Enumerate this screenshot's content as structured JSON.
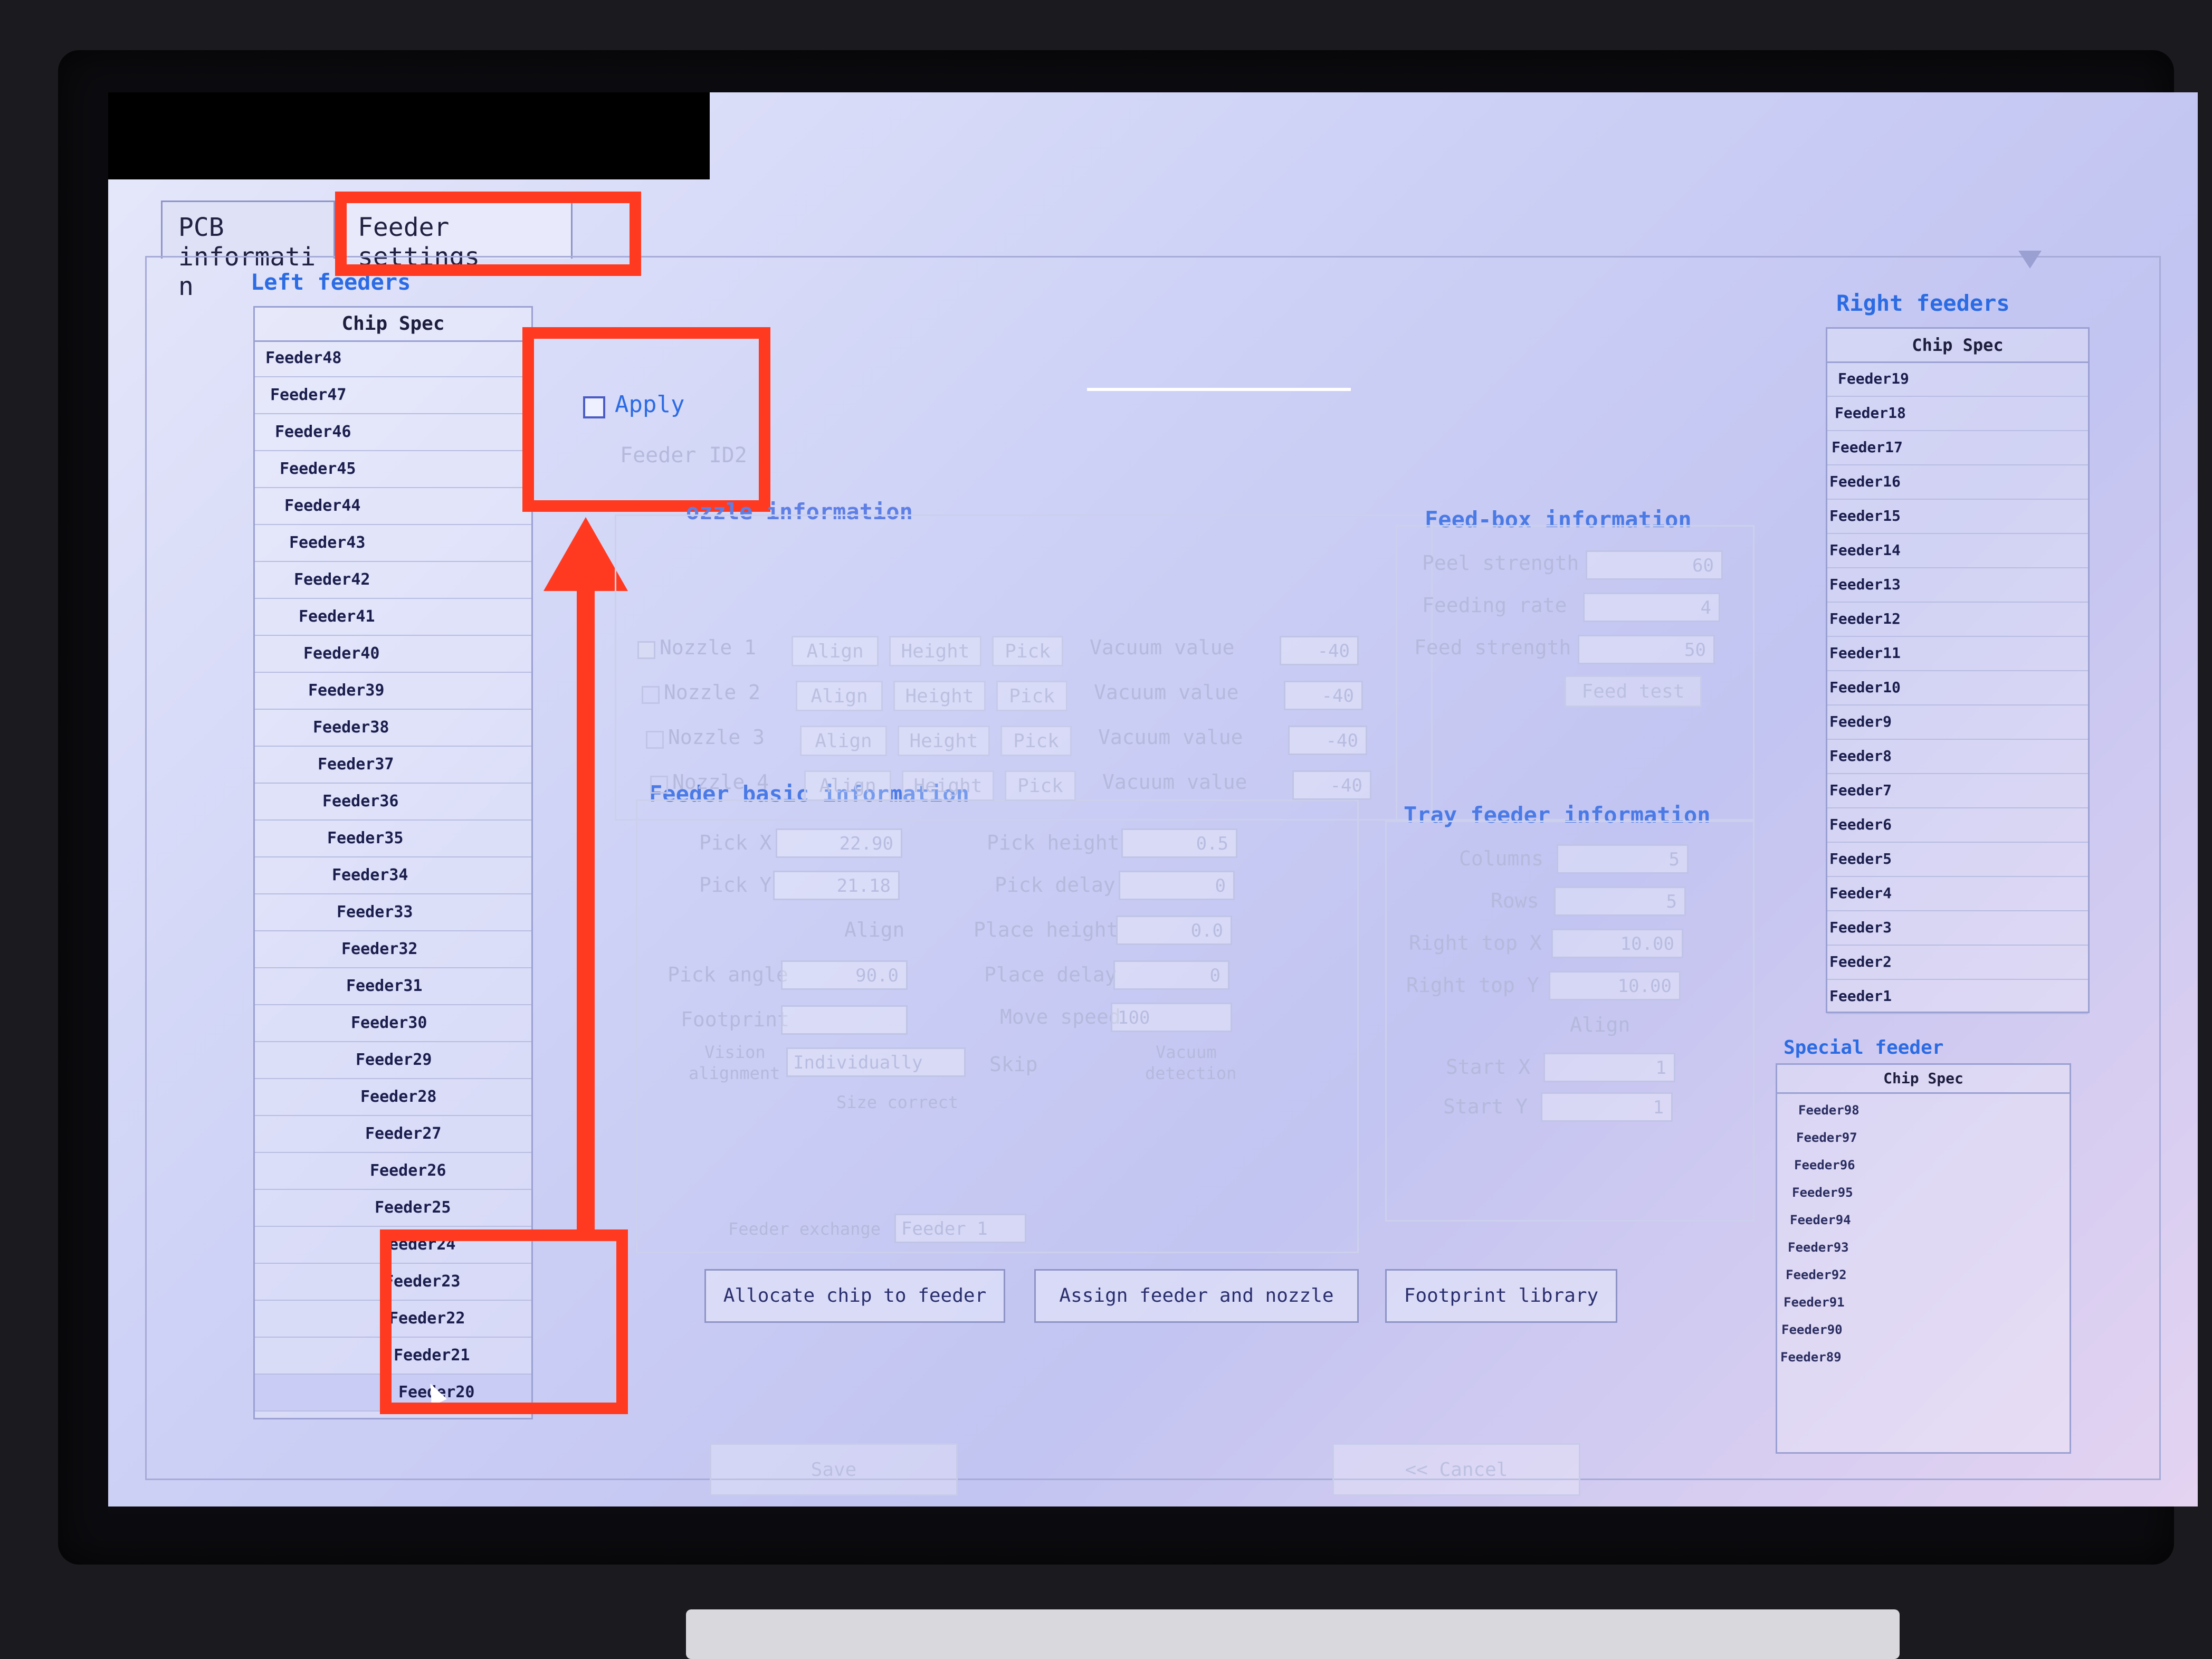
{
  "tabs": [
    {
      "label": "PCB informati n"
    },
    {
      "label": "Feeder settings"
    }
  ],
  "left_feeders": {
    "title": "Left feeders",
    "column": "Chip Spec",
    "rows": [
      "Feeder48",
      "Feeder47",
      "Feeder46",
      "Feeder45",
      "Feeder44",
      "Feeder43",
      "Feeder42",
      "Feeder41",
      "Feeder40",
      "Feeder39",
      "Feeder38",
      "Feeder37",
      "Feeder36",
      "Feeder35",
      "Feeder34",
      "Feeder33",
      "Feeder32",
      "Feeder31",
      "Feeder30",
      "Feeder29",
      "Feeder28",
      "Feeder27",
      "Feeder26",
      "Feeder25",
      "Feeder24",
      "Feeder23",
      "Feeder22",
      "Feeder21",
      "Feeder20"
    ],
    "selected": "Feeder20"
  },
  "right_feeders": {
    "title": "Right feeders",
    "column": "Chip Spec",
    "rows": [
      "Feeder19",
      "Feeder18",
      "Feeder17",
      "Feeder16",
      "Feeder15",
      "Feeder14",
      "Feeder13",
      "Feeder12",
      "Feeder11",
      "Feeder10",
      "Feeder9",
      "Feeder8",
      "Feeder7",
      "Feeder6",
      "Feeder5",
      "Feeder4",
      "Feeder3",
      "Feeder2",
      "Feeder1"
    ]
  },
  "special_feeder": {
    "title": "Special feeder",
    "column": "Chip Spec",
    "rows": [
      "Feeder98",
      "Feeder97",
      "Feeder96",
      "Feeder95",
      "Feeder94",
      "Feeder93",
      "Feeder92",
      "Feeder91",
      "Feeder90",
      "Feeder89"
    ]
  },
  "apply": {
    "label": "Apply",
    "checked": false
  },
  "feeder_id": "Feeder ID2",
  "nozzle_section": {
    "title": "ozzle information"
  },
  "nozzles": [
    {
      "label": "Nozzle 1",
      "checked": true,
      "value": "-40"
    },
    {
      "label": "Nozzle 2",
      "checked": false,
      "value": "-40"
    },
    {
      "label": "Nozzle 3",
      "checked": false,
      "value": "-40"
    },
    {
      "label": "Nozzle 4",
      "checked": false,
      "value": "-40"
    }
  ],
  "nozzle_buttons": {
    "align": "Align",
    "height": "Height",
    "pick": "Pick",
    "vacuum": "Vacuum value"
  },
  "feedbox": {
    "title": "Feed-box information",
    "peel_label": "Peel strength",
    "peel_value": "60",
    "rate_label": "Feeding rate",
    "rate_value": "4",
    "strength_label": "Feed strength",
    "strength_value": "50",
    "test_label": "Feed test"
  },
  "basic": {
    "title": "Feeder basic information",
    "pick_x_label": "Pick X",
    "pick_x_value": "22.90",
    "pick_y_label": "Pick Y",
    "pick_y_value": "21.18",
    "align_label": "Align",
    "pick_angle_label": "Pick angle",
    "pick_angle_value": "90.0",
    "footprint_label": "Footprint",
    "footprint_value": "",
    "vision_label_1": "Vision",
    "vision_label_2": "alignment",
    "vision_value": "Individually",
    "skip_label": "Skip",
    "vacuum_label_1": "Vacuum",
    "vacuum_label_2": "detection",
    "size_correct_label": "Size correct",
    "pick_height_label": "Pick height",
    "pick_height_value": "0.5",
    "pick_delay_label": "Pick delay",
    "pick_delay_value": "0",
    "place_height_label": "Place height",
    "place_height_value": "0.0",
    "place_delay_label": "Place delay",
    "place_delay_value": "0",
    "move_speed_label": "Move speed",
    "move_speed_value": "100",
    "exchange_label": "Feeder exchange",
    "exchange_value": "Feeder 1"
  },
  "tray": {
    "title": "Tray feeder information",
    "columns_label": "Columns",
    "columns_value": "5",
    "rows_label": "Rows",
    "rows_value": "5",
    "rtx_label": "Right top X",
    "rtx_value": "10.00",
    "rty_label": "Right top Y",
    "rty_value": "10.00",
    "align_label": "Align",
    "start_x_label": "Start X",
    "start_x_value": "1",
    "start_y_label": "Start Y",
    "start_y_value": "1"
  },
  "actions": {
    "allocate": "Allocate chip to feeder",
    "assign": "Assign feeder and nozzle",
    "footprint": "Footprint library",
    "save": "Save",
    "cancel": "<< Cancel"
  },
  "colors": {
    "highlight": "#ff3a20",
    "accent": "#2b6be3"
  }
}
